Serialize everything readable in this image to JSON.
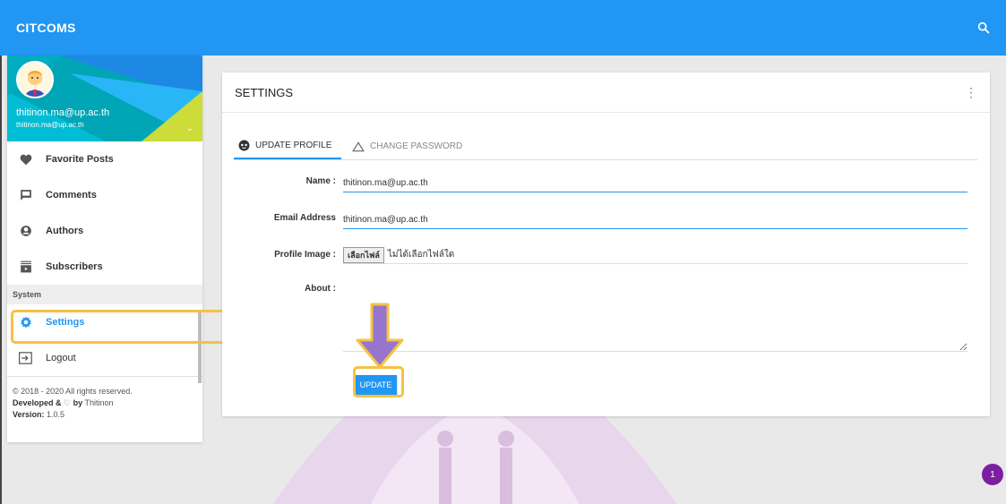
{
  "app": {
    "brand": "CITCOMS"
  },
  "colors": {
    "primary": "#2196F3",
    "highlight": "#F5C242",
    "arrow": "#9575CD",
    "badge": "#7b1fa2"
  },
  "topbar": {
    "search_icon": "search-icon"
  },
  "user": {
    "name": "thitinon.ma@up.ac.th",
    "email": "thitinon.ma@up.ac.th"
  },
  "sidebar": {
    "items": [
      {
        "label": "Favorite Posts",
        "icon": "heart-icon"
      },
      {
        "label": "Comments",
        "icon": "comment-icon"
      },
      {
        "label": "Authors",
        "icon": "account-icon"
      },
      {
        "label": "Subscribers",
        "icon": "subscribers-icon"
      }
    ],
    "section_header": "System",
    "settings_label": "Settings",
    "logout_label": "Logout"
  },
  "footer": {
    "copyright": "© 2018 - 2020 All rights reserved.",
    "developed_prefix": "Developed &",
    "developed_by": "by",
    "developer": "Thitinon",
    "version_label": "Version:",
    "version": "1.0.5"
  },
  "card": {
    "title": "SETTINGS",
    "tabs": [
      {
        "label": "UPDATE PROFILE",
        "icon": "face-icon",
        "active": true
      },
      {
        "label": "CHANGE PASSWORD",
        "icon": "triangle-icon",
        "active": false
      }
    ],
    "form": {
      "name_label": "Name :",
      "name_value": "thitinon.ma@up.ac.th",
      "email_label": "Email Address",
      "email_value": "thitinon.ma@up.ac.th",
      "image_label": "Profile Image :",
      "file_button": "เลือกไฟล์",
      "file_status": "ไม่ได้เลือกไฟล์ใด",
      "about_label": "About :",
      "about_value": ""
    },
    "update_button": "UPDATE"
  },
  "badge": {
    "count": "1"
  }
}
